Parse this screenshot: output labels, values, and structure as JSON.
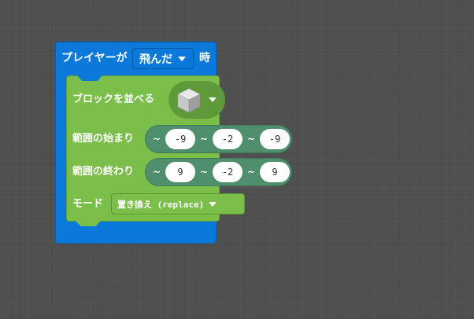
{
  "event": {
    "label_prefix": "プレイヤーが",
    "dropdown_value": "飛んだ",
    "label_suffix": "時",
    "color": "#0a79d9"
  },
  "command": {
    "label": "ブロックを並べる",
    "block_value": "cube",
    "color": "#7bbf4a",
    "from": {
      "label": "範囲の始まり",
      "x": "-9",
      "y": "-2",
      "z": "-9"
    },
    "to": {
      "label": "範囲の終わり",
      "x": "9",
      "y": "-2",
      "z": "9"
    },
    "mode": {
      "label": "モード",
      "value": "置き換え (replace)"
    },
    "tilde": "~"
  }
}
